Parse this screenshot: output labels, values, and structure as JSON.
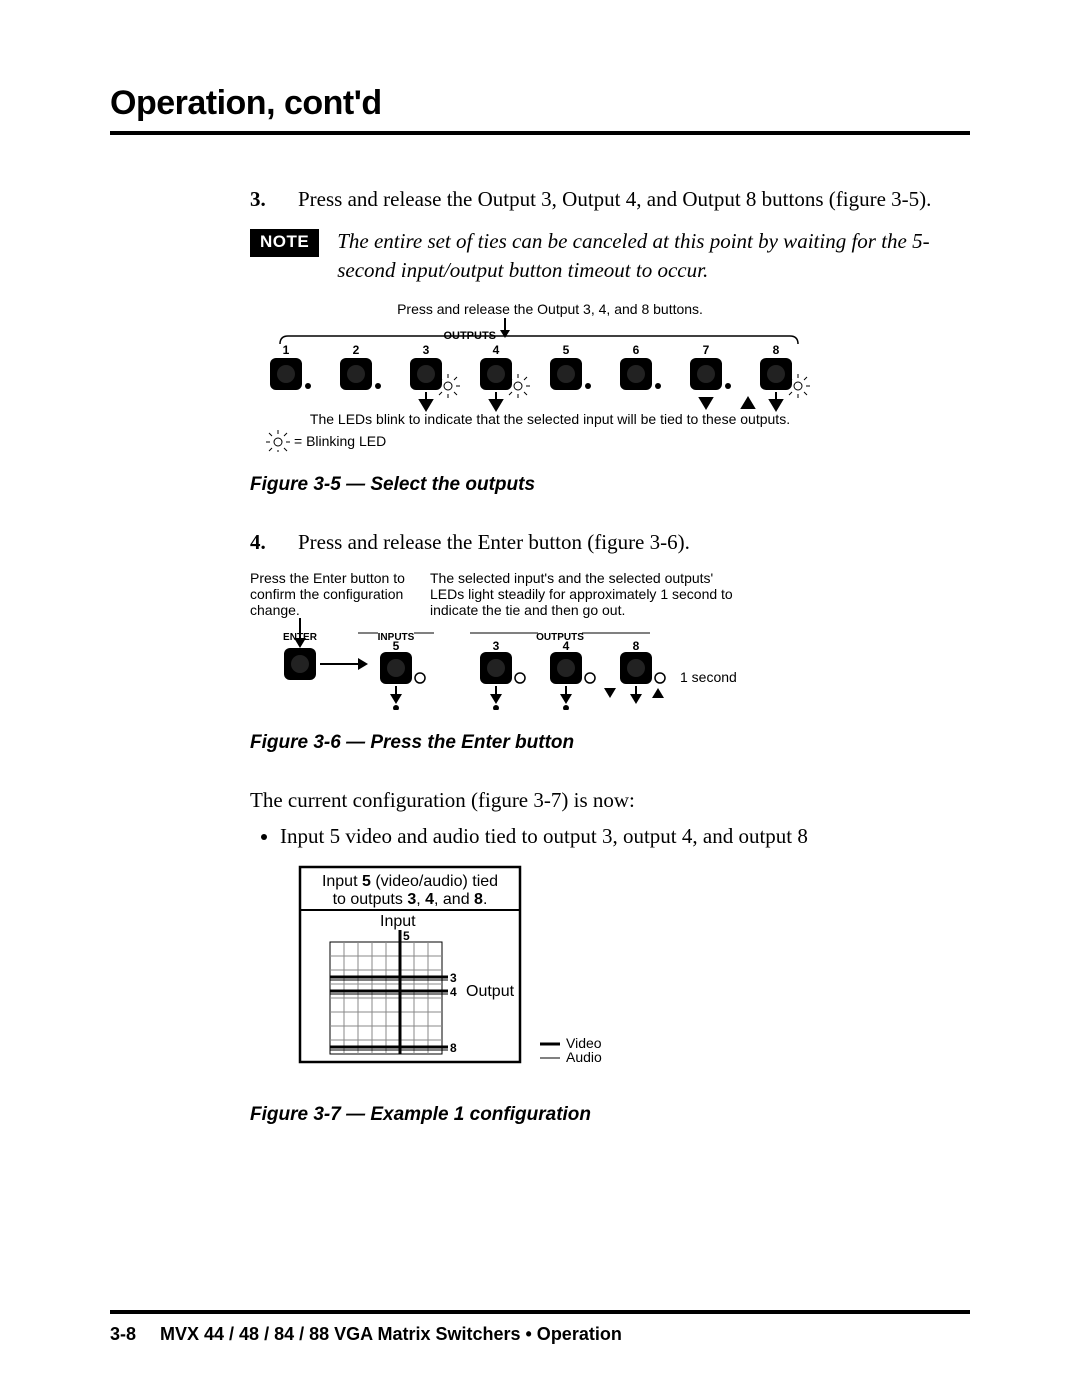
{
  "header": {
    "title": "Operation, cont'd"
  },
  "step3": {
    "num": "3.",
    "text": "Press and release the Output 3, Output 4, and Output 8 buttons (figure 3-5)."
  },
  "note": {
    "badge": "NOTE",
    "text": "The entire set of ties can be canceled at this point by waiting for the 5-second input/output button timeout to occur."
  },
  "fig5": {
    "top_label": "Press and release the Output 3, 4, and 8 buttons.",
    "group_label": "OUTPUTS",
    "button_numbers": [
      "1",
      "2",
      "3",
      "4",
      "5",
      "6",
      "7",
      "8"
    ],
    "bottom_label": "The LEDs blink to indicate that the selected input will be tied to these outputs.",
    "legend": "= Blinking LED",
    "caption": "Figure 3-5 — Select the outputs"
  },
  "step4": {
    "num": "4.",
    "text": "Press and release the Enter button (figure 3-6)."
  },
  "fig6": {
    "left_note": "Press the Enter button to confirm the configuration change.",
    "right_note": "The selected input's and the selected outputs' LEDs light steadily for approximately 1 second to indicate the tie and then go out.",
    "enter_label": "ENTER",
    "inputs_label": "INPUTS",
    "outputs_label": "OUTPUTS",
    "input_num": "5",
    "output_nums": [
      "3",
      "4",
      "8"
    ],
    "duration": "1 second",
    "caption": "Figure 3-6 — Press the Enter button"
  },
  "summary": {
    "lead": "The current configuration (figure 3-7) is now:",
    "bullet": "Input 5 video and audio tied to output 3, output 4, and output 8"
  },
  "fig7": {
    "box_line1a": "Input ",
    "box_line1_bold": "5",
    "box_line1b": " (video/audio) tied",
    "box_line2a": "to outputs ",
    "box_line2_bold1": "3",
    "box_line2_mid1": ", ",
    "box_line2_bold2": "4",
    "box_line2_mid2": ", and ",
    "box_line2_bold3": "8",
    "box_line2_end": ".",
    "input_label": "Input",
    "input_num": "5",
    "output_label": "Output",
    "output_nums": {
      "r3": "3",
      "r4": "4",
      "r8": "8"
    },
    "legend_video": "Video",
    "legend_audio": "Audio",
    "caption": "Figure 3-7 — Example 1 configuration"
  },
  "footer": {
    "page": "3-8",
    "title": "MVX 44 / 48 / 84 / 88 VGA Matrix Switchers • Operation"
  }
}
